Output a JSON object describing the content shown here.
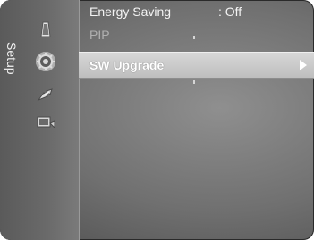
{
  "sidebar": {
    "section_label": "Setup",
    "icons": [
      "picture-icon",
      "setup-gear-icon",
      "satellite-icon",
      "input-icon"
    ]
  },
  "menu": {
    "items": [
      {
        "label": "Energy Saving",
        "value": ": Off",
        "state": "normal"
      },
      {
        "label": "PIP",
        "value": "",
        "state": "disabled"
      },
      {
        "label": "SW Upgrade",
        "value": "",
        "state": "selected"
      }
    ]
  }
}
